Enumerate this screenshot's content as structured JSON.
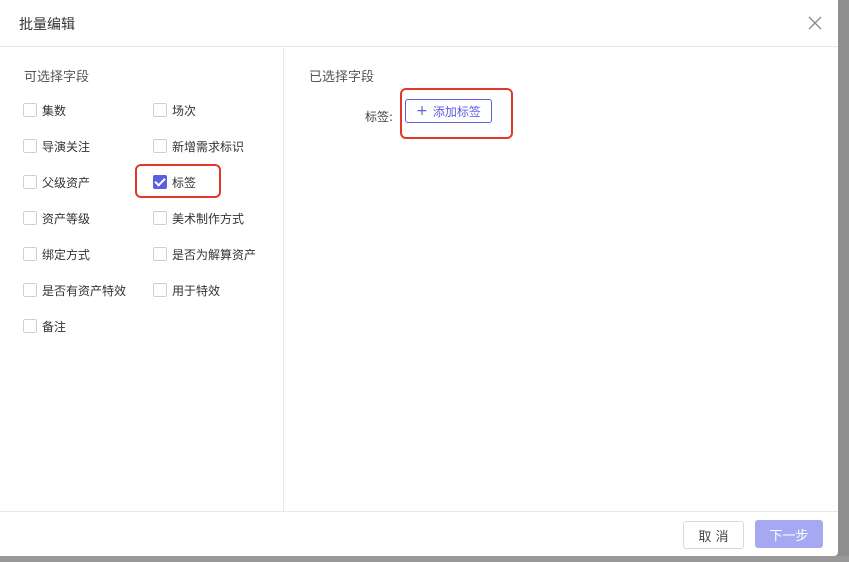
{
  "dialog": {
    "title": "批量编辑"
  },
  "left": {
    "title": "可选择字段",
    "fields": [
      {
        "label": "集数",
        "checked": false
      },
      {
        "label": "场次",
        "checked": false
      },
      {
        "label": "导演关注",
        "checked": false
      },
      {
        "label": "新增需求标识",
        "checked": false
      },
      {
        "label": "父级资产",
        "checked": false
      },
      {
        "label": "标签",
        "checked": true
      },
      {
        "label": "资产等级",
        "checked": false
      },
      {
        "label": "美术制作方式",
        "checked": false
      },
      {
        "label": "绑定方式",
        "checked": false
      },
      {
        "label": "是否为解算资产",
        "checked": false
      },
      {
        "label": "是否有资产特效",
        "checked": false
      },
      {
        "label": "用于特效",
        "checked": false
      },
      {
        "label": "备注",
        "checked": false
      }
    ]
  },
  "right": {
    "title": "已选择字段",
    "tag_field_label": "标签:",
    "add_tag_label": "添加标签"
  },
  "footer": {
    "cancel_label": "取 消",
    "next_label": "下一步"
  },
  "colors": {
    "accent": "#5b5fe0",
    "highlight": "#e0382a",
    "next_disabled": "#a6a9f2"
  }
}
